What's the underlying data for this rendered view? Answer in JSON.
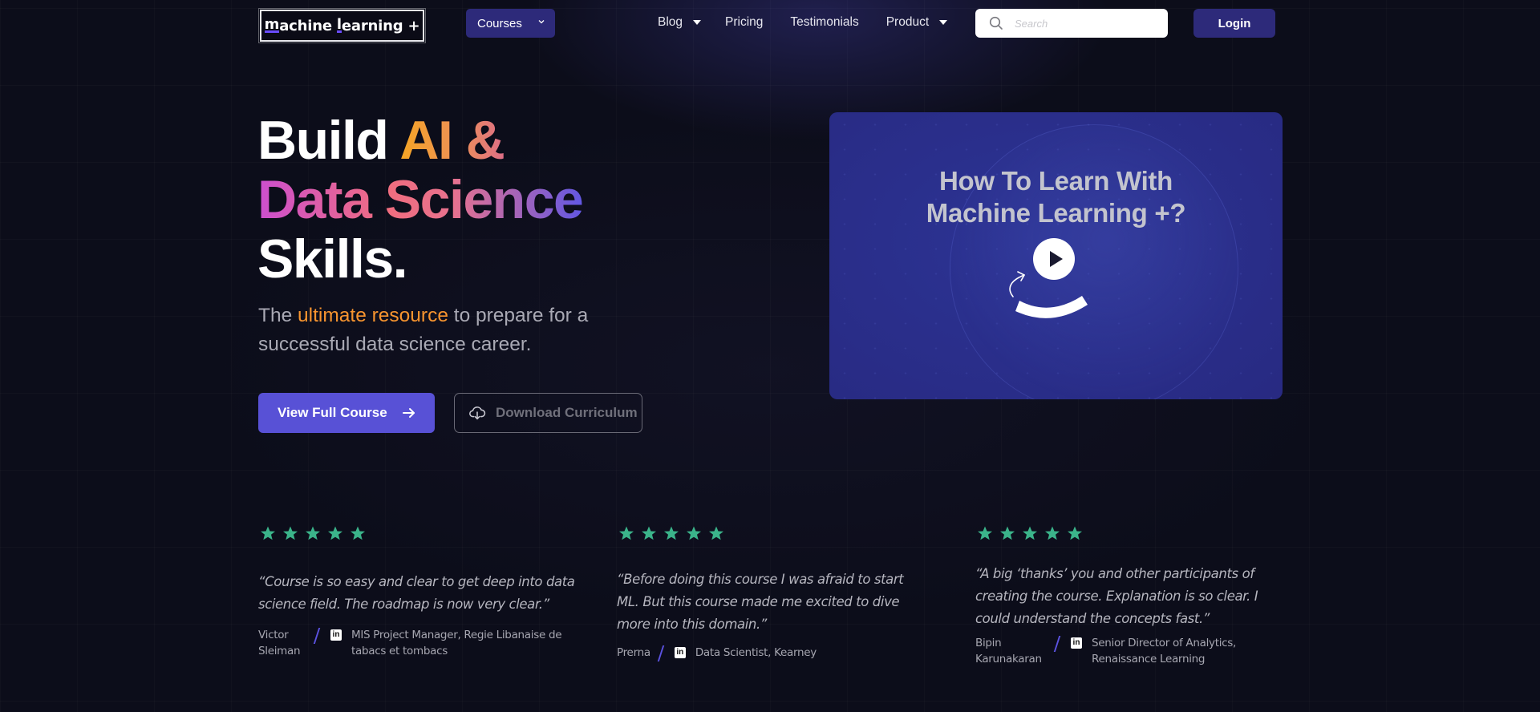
{
  "nav": {
    "logo": {
      "part1": "m",
      "part2": "achine ",
      "part3": "l",
      "part4": "earning +"
    },
    "courses_label": "Courses",
    "links": [
      {
        "label": "Blog",
        "has_dropdown": true
      },
      {
        "label": "Pricing",
        "has_dropdown": false
      },
      {
        "label": "Testimonials",
        "has_dropdown": false
      },
      {
        "label": "Product",
        "has_dropdown": true
      }
    ],
    "search_placeholder": "Search",
    "search_value": "",
    "login_label": "Login"
  },
  "hero": {
    "title": {
      "line1_plain": "Build ",
      "line1_accent": "AI &",
      "line2_accent": "Data Science",
      "line3": "Skills."
    },
    "subtitle": {
      "before": "The ",
      "highlight": "ultimate resource",
      "after": " to prepare for a successful data science career."
    },
    "primary_button": "View Full Course",
    "secondary_button": "Download Curriculum"
  },
  "video": {
    "title_line1": "How To Learn With",
    "title_line2": "Machine Learning +?"
  },
  "testimonials": [
    {
      "rating": 5,
      "quote": "“Course is so easy and clear to get deep into data science field. The roadmap is now very clear.”",
      "name_line1": "Victor",
      "name_line2": "Sleiman",
      "role_line1": "MIS Project Manager, Regie Libanaise de",
      "role_line2": "tabacs et tombacs"
    },
    {
      "rating": 5,
      "quote": "“Before doing this course I was afraid to start ML. But this course made me excited to dive more into this domain.”",
      "name_line1": "Prerna",
      "name_line2": "",
      "role_line1": "Data Scientist, Kearney",
      "role_line2": ""
    },
    {
      "rating": 5,
      "quote": "“A big ‘thanks’ you and other participants of creating the course. Explanation is so clear. I could understand the concepts fast.”",
      "name_line1": "Bipin",
      "name_line2": "Karunakaran",
      "role_line1": "Senior Director of Analytics,",
      "role_line2": "Renaissance Learning"
    }
  ],
  "icons": {
    "linkedin_glyph": "in"
  },
  "colors": {
    "background": "#0c0d1a",
    "nav_button": "#2d2a7a",
    "primary_button": "#5851d6",
    "highlight_orange": "#f7942f",
    "star_green": "#3bb48a",
    "video_bg": "#2a2f8c"
  }
}
